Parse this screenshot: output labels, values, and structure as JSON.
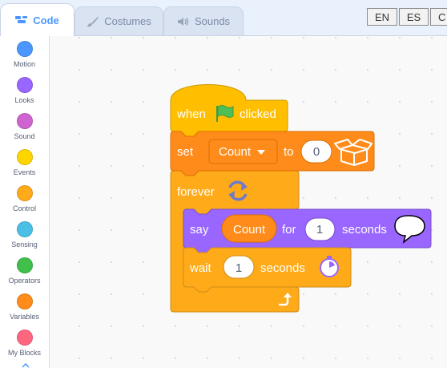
{
  "tabs": [
    {
      "label": "Code",
      "icon": "code-icon"
    },
    {
      "label": "Costumes",
      "icon": "brush-icon"
    },
    {
      "label": "Sounds",
      "icon": "speaker-icon"
    }
  ],
  "languages": [
    "EN",
    "ES",
    "C"
  ],
  "categories": [
    {
      "label": "Motion",
      "color": "#4c97ff"
    },
    {
      "label": "Looks",
      "color": "#9966ff"
    },
    {
      "label": "Sound",
      "color": "#cf63cf"
    },
    {
      "label": "Events",
      "color": "#ffd500"
    },
    {
      "label": "Control",
      "color": "#ffab19"
    },
    {
      "label": "Sensing",
      "color": "#4cbfe6"
    },
    {
      "label": "Operators",
      "color": "#40bf4a"
    },
    {
      "label": "Variables",
      "color": "#ff8c1a"
    },
    {
      "label": "My Blocks",
      "color": "#ff6680"
    }
  ],
  "script": {
    "hat": {
      "when": "when",
      "clicked": "clicked",
      "icon": "green-flag-icon"
    },
    "set": {
      "label": "set",
      "variable": "Count",
      "to": "to",
      "value": "0",
      "icon": "variables-box-icon"
    },
    "forever": {
      "label": "forever",
      "icon": "loop-arrows-icon",
      "end_icon": "loop-return-icon"
    },
    "say": {
      "label": "say",
      "reporter": "Count",
      "for": "for",
      "value": "1",
      "seconds": "seconds",
      "icon": "speech-bubble-icon"
    },
    "wait": {
      "label": "wait",
      "value": "1",
      "seconds": "seconds",
      "icon": "stopwatch-icon"
    }
  },
  "colors": {
    "events": "#ffbf00",
    "variables": "#ff8c1a",
    "control": "#ffab19",
    "looks": "#9966ff",
    "accent": "#4c97ff"
  }
}
